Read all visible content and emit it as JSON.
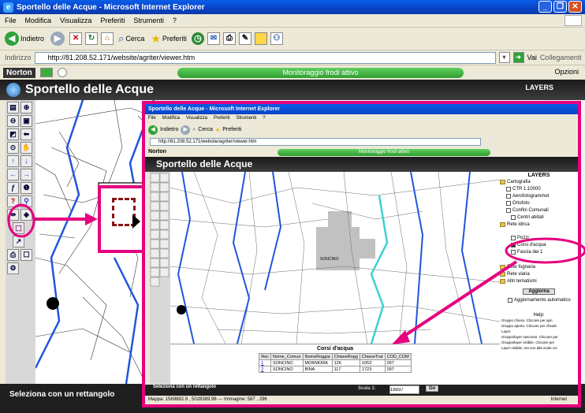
{
  "window": {
    "title": "Sportello delle Acque - Microsoft Internet Explorer",
    "menu": [
      "File",
      "Modifica",
      "Visualizza",
      "Preferiti",
      "Strumenti",
      "?"
    ]
  },
  "toolbar": {
    "back_label": "Indietro",
    "search_label": "Cerca",
    "favorites_label": "Preferiti"
  },
  "address": {
    "label": "Indirizzo",
    "url": "http://81.208.52.171/website/agriter/viewer.htm",
    "go_label": "Vai",
    "links_label": "Collegamenti"
  },
  "norton": {
    "brand": "Norton",
    "status": "Monitoraggio frodi attivo",
    "options_label": "Opzioni"
  },
  "app": {
    "title": "Sportello delle Acque",
    "status_text": "Seleziona con un rettangolo",
    "layers_header": "LAYERS"
  },
  "inset": {
    "title": "Sportello delle Acque - Microsoft Internet Explorer",
    "menu": [
      "File",
      "Modifica",
      "Visualizza",
      "Preferiti",
      "Strumenti",
      "?"
    ],
    "address_url": "http://81.208.52.171/website/agriter/viewer.htm",
    "norton_brand": "Norton",
    "norton_status": "Monitoraggio frodi attivo",
    "app_title": "Sportello delle Acque",
    "map_label": "SONCINO",
    "layers": {
      "header": "LAYERS",
      "items": [
        "Cartografia",
        "CTR 1:10000",
        "Aerofotogrammet",
        "Ortofoto",
        "Confini Comunali",
        "Centri abitati",
        "Rete idrica",
        "Pozzi",
        "Corsi d'acqua",
        "Fascia dei 1",
        "Rete fognaria",
        "Rete viaria",
        "Altri tematismi"
      ],
      "refresh_button": "Aggiorna",
      "auto_update_label": "Aggiornamento automatico",
      "help_title": "Help:",
      "help_lines": [
        "Gruppo chiuso. Cliccare per apri.",
        "Gruppo aperto. Cliccare per chiude",
        "Layer.",
        "Gruppo/layer nascosto. Cliccare per",
        "Gruppo/layer visibile. Cliccare per",
        "Layer visibile, ma non alla scala cor"
      ]
    },
    "results": {
      "title": "Corsi d'acqua",
      "columns": [
        "Rec",
        "Nome_Comun",
        "NomeRoggia",
        "ChiaveRogg",
        "ChiaveTrat",
        "COD_COM"
      ],
      "rows": [
        [
          "1",
          "SONCINO",
          "MORMORA",
          "126",
          "1053",
          "097"
        ],
        [
          "2",
          "SONCINO",
          "BINA",
          "117",
          "1723",
          "097"
        ]
      ]
    },
    "status_text": "Seleziona con un rettangolo",
    "scale_label": "Scala 1:",
    "scale_value": "18937",
    "scale_go": "Go",
    "bottom_status": "Mappa: 1569882.9 , 5028389.98 --- Immagine: 587 , 296",
    "internet_label": "Internet"
  },
  "colors": {
    "accent_magenta": "#e5007e",
    "xp_blue": "#0843c5",
    "norton_green": "#3aae3a",
    "river_blue": "#2255dd",
    "selected_canal": "#3fd0d0"
  }
}
